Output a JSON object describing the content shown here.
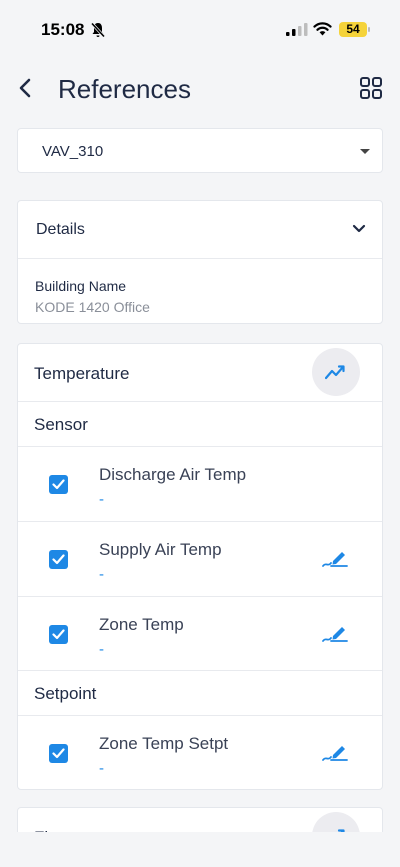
{
  "status_bar": {
    "time": "15:08",
    "battery": "54"
  },
  "header": {
    "title": "References"
  },
  "selector": {
    "value": "VAV_310"
  },
  "details": {
    "title": "Details",
    "building_label": "Building Name",
    "building_value": "KODE 1420 Office"
  },
  "temperature": {
    "title": "Temperature",
    "sensor_label": "Sensor",
    "setpoint_label": "Setpoint",
    "sensor_points": [
      {
        "name": "Discharge Air Temp",
        "value": "-"
      },
      {
        "name": "Supply Air Temp",
        "value": "-"
      },
      {
        "name": "Zone Temp",
        "value": "-"
      }
    ],
    "setpoint_points": [
      {
        "name": "Zone Temp Setpt",
        "value": "-"
      }
    ]
  },
  "next_card": {
    "title": "Flow"
  },
  "colors": {
    "accent": "#1e88e5",
    "text": "#1f2a44",
    "battery": "#f5d33a"
  }
}
